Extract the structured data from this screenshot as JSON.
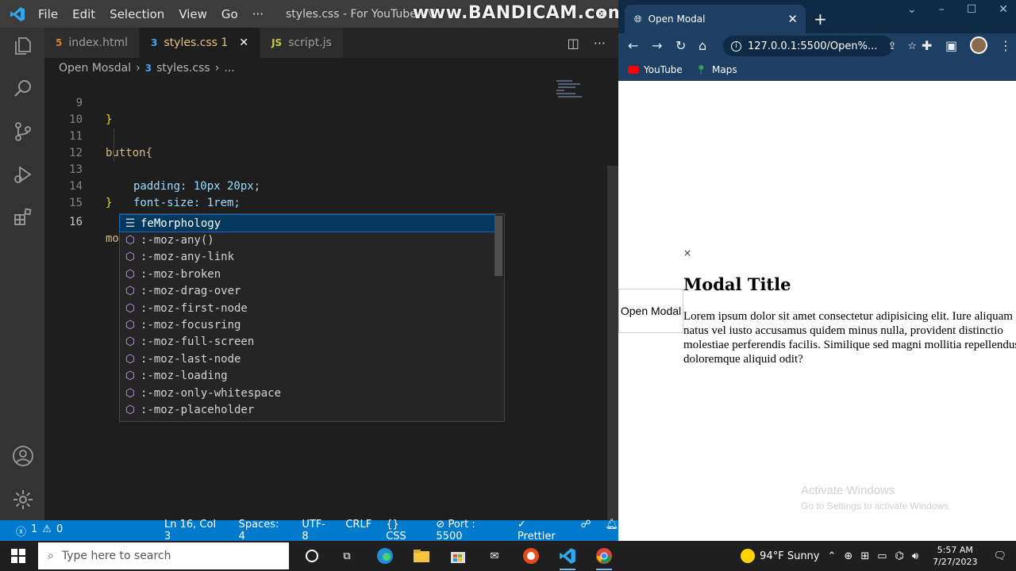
{
  "vscode": {
    "menu": [
      "File",
      "Edit",
      "Selection",
      "View",
      "Go",
      "···"
    ],
    "window_title": "styles.css - For YouTube - V",
    "watermark": "www.BANDICAM.com",
    "tabs": [
      {
        "icon": "5",
        "label": "index.html",
        "color": "#e37933"
      },
      {
        "icon": "3",
        "label": "styles.css 1",
        "color": "#42a5f5"
      },
      {
        "icon": "JS",
        "label": "script.js",
        "color": "#cbcb41"
      }
    ],
    "breadcrumb": {
      "folder": "Open Mosdal",
      "file": "styles.css",
      "more": "..."
    },
    "lines": [
      {
        "n": "9",
        "text": "}"
      },
      {
        "n": "10",
        "text": ""
      },
      {
        "n": "11",
        "text": "button{"
      },
      {
        "n": "12",
        "text": "padding: 10px 20px;"
      },
      {
        "n": "13",
        "text": "font-size: 1rem;"
      },
      {
        "n": "14",
        "text": "}"
      },
      {
        "n": "15",
        "text": ""
      },
      {
        "n": "16",
        "text": "mo"
      }
    ],
    "suggestions": [
      "feMorphology",
      ":-moz-any()",
      ":-moz-any-link",
      ":-moz-broken",
      ":-moz-drag-over",
      ":-moz-first-node",
      ":-moz-focusring",
      ":-moz-full-screen",
      ":-moz-last-node",
      ":-moz-loading",
      ":-moz-only-whitespace",
      ":-moz-placeholder"
    ],
    "status": {
      "errors": "1",
      "warnings": "0",
      "position": "Ln 16, Col 3",
      "spaces": "Spaces: 4",
      "encoding": "UTF-8",
      "eol": "CRLF",
      "language": "CSS",
      "port": "Port : 5500",
      "formatter": "Prettier"
    }
  },
  "chrome": {
    "tab_title": "Open Modal",
    "url": "127.0.0.1:5500/Open%...",
    "bookmarks": [
      "YouTube",
      "Maps"
    ],
    "page": {
      "open_button": "Open Modal",
      "close": "×",
      "modal_title": "Modal Title",
      "modal_body": "Lorem ipsum dolor sit amet consectetur adipisicing elit. Iure aliquam natus vel iusto accusamus quidem minus nulla, provident distinctio molestiae perferendis facilis. Similique sed magni mollitia repellendus doloremque aliquid odit?",
      "watermark_1": "Activate Windows",
      "watermark_2": "Go to Settings to activate Windows."
    }
  },
  "taskbar": {
    "search_placeholder": "Type here to search",
    "weather": "94°F  Sunny",
    "time": "5:57 AM",
    "date": "7/27/2023"
  }
}
